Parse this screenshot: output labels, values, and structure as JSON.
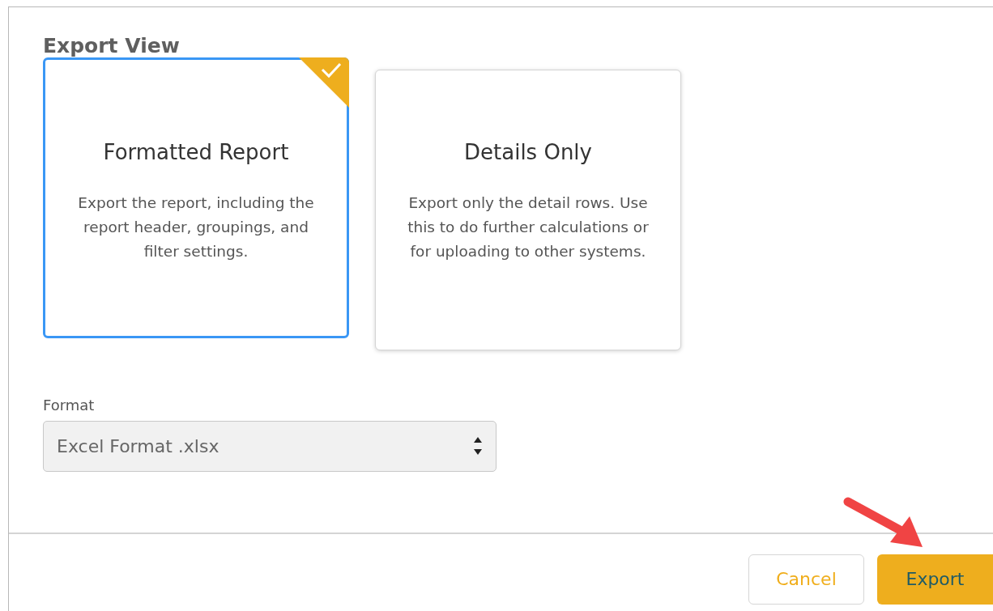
{
  "dialog": {
    "title": "Export View",
    "options": [
      {
        "title": "Formatted Report",
        "description": "Export the report, including the report header, groupings, and filter settings.",
        "selected": true
      },
      {
        "title": "Details Only",
        "description": "Export only the detail rows. Use this to do further calculations or for uploading to other systems.",
        "selected": false
      }
    ],
    "format": {
      "label": "Format",
      "value": "Excel Format .xlsx"
    },
    "buttons": [
      {
        "label": "Cancel",
        "kind": "secondary"
      },
      {
        "label": "Export",
        "kind": "primary"
      }
    ]
  }
}
